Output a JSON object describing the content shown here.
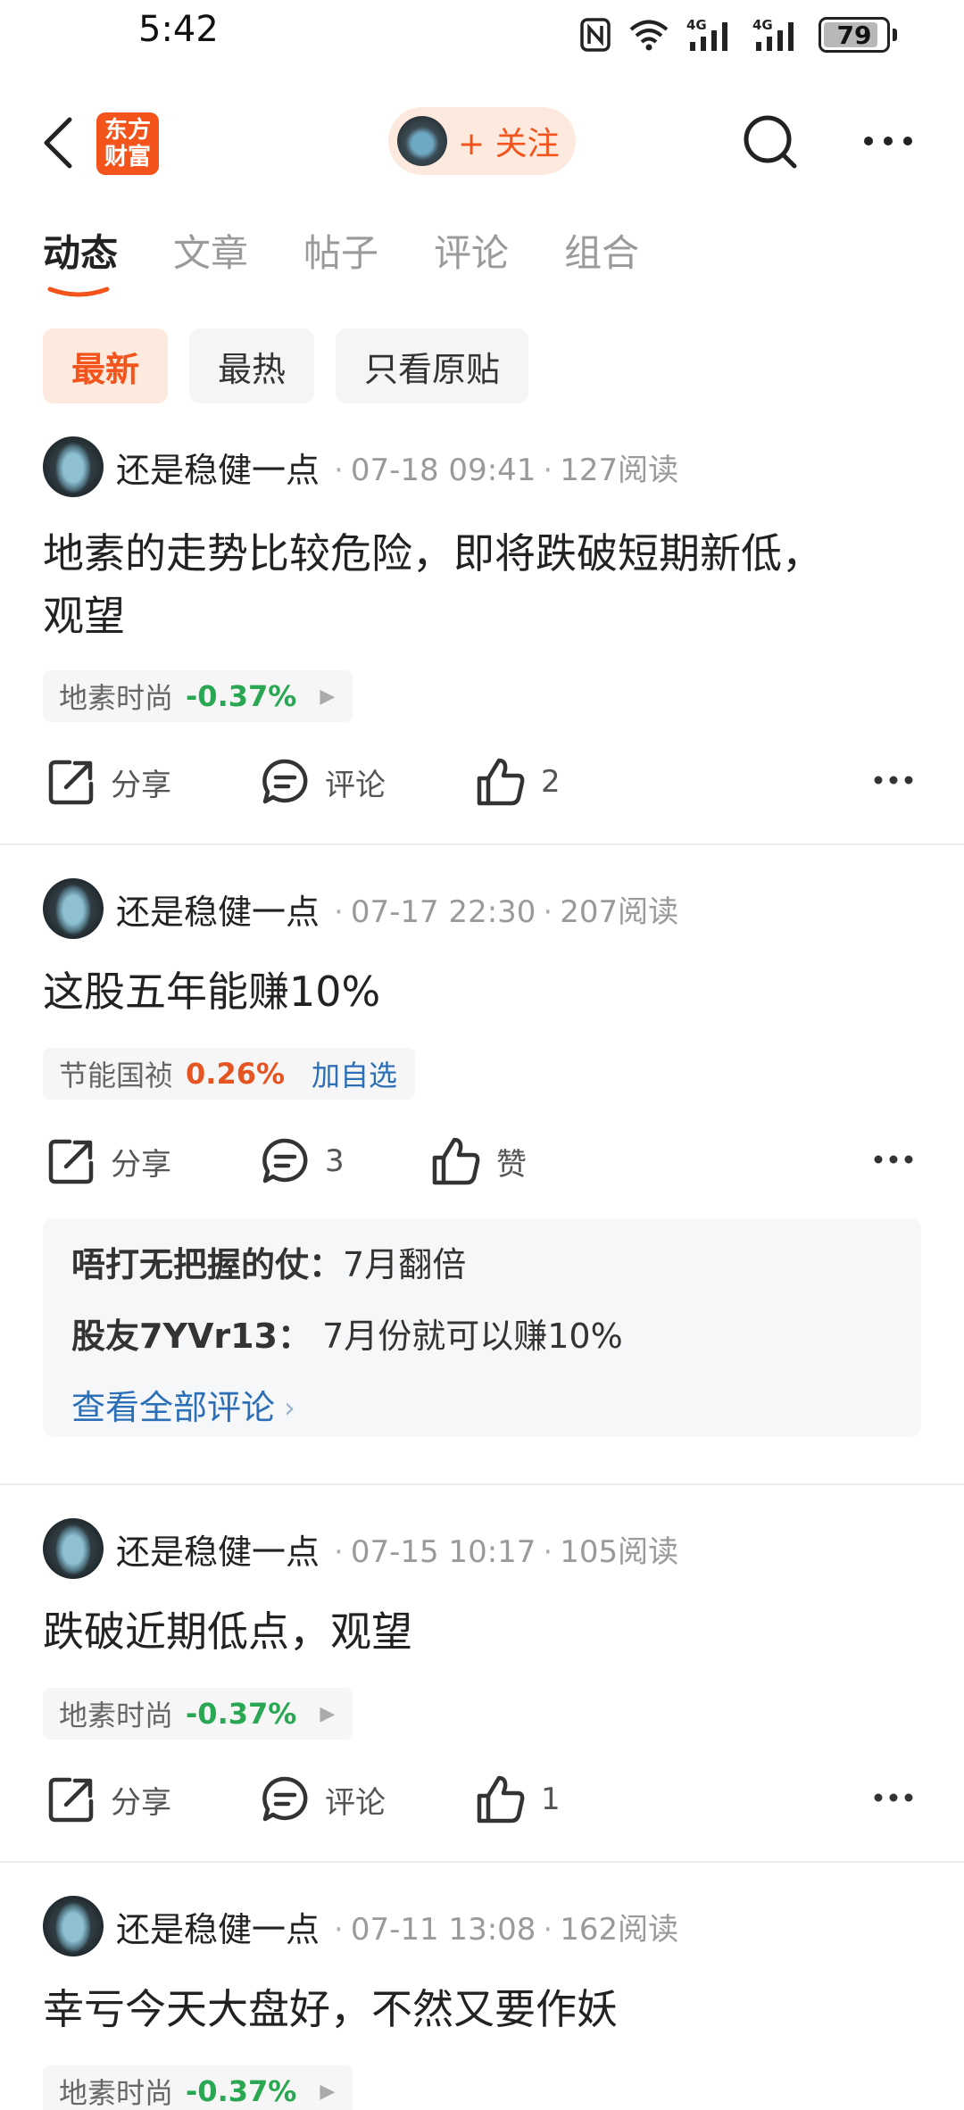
{
  "status_bar": {
    "time": "5:42",
    "battery": "79",
    "net1": "4G",
    "net2": "4G"
  },
  "nav": {
    "logo_line1": "东方",
    "logo_line2": "财富",
    "follow_label": "+ 关注"
  },
  "tabs": [
    {
      "label": "动态"
    },
    {
      "label": "文章"
    },
    {
      "label": "帖子"
    },
    {
      "label": "评论"
    },
    {
      "label": "组合"
    }
  ],
  "filters": [
    {
      "label": "最新"
    },
    {
      "label": "最热"
    },
    {
      "label": "只看原贴"
    }
  ],
  "posts": [
    {
      "author": "还是稳健一点",
      "time": "07-18 09:41",
      "reads": "127阅读",
      "text_line1": "地素的走势比较危险，即将跌破短期新低，",
      "text_line2": "观望",
      "stock_name": "地素时尚",
      "stock_change": "-0.37%",
      "share_label": "分享",
      "comment_label": "评论",
      "like_label": "2"
    },
    {
      "author": "还是稳健一点",
      "time": "07-17 22:30",
      "reads": "207阅读",
      "text_line1": "这股五年能赚10%",
      "stock_name": "节能国祯",
      "stock_change": "0.26%",
      "stock_add": "加自选",
      "share_label": "分享",
      "comment_label": "3",
      "like_label": "赞",
      "comments": [
        {
          "user": "唔打无把握的仗：",
          "text": "7月翻倍"
        },
        {
          "user": "股友7YVr13：",
          "text": " 7月份就可以赚10%"
        }
      ],
      "view_all": "查看全部评论"
    },
    {
      "author": "还是稳健一点",
      "time": "07-15 10:17",
      "reads": "105阅读",
      "text_line1": "跌破近期低点，观望",
      "stock_name": "地素时尚",
      "stock_change": "-0.37%",
      "share_label": "分享",
      "comment_label": "评论",
      "like_label": "1"
    },
    {
      "author": "还是稳健一点",
      "time": "07-11 13:08",
      "reads": "162阅读",
      "text_line1": "幸亏今天大盘好，不然又要作妖",
      "stock_name": "地素时尚",
      "stock_change": "-0.37%"
    }
  ],
  "colors": {
    "accent": "#f2541b",
    "down": "#2aa752",
    "up": "#e55521",
    "link": "#2b6fb6"
  },
  "icons": [
    "back-icon",
    "search-icon",
    "more-icon",
    "share-icon",
    "comment-icon",
    "like-icon",
    "nfc-icon",
    "wifi-icon",
    "signal-icon",
    "battery-icon"
  ]
}
